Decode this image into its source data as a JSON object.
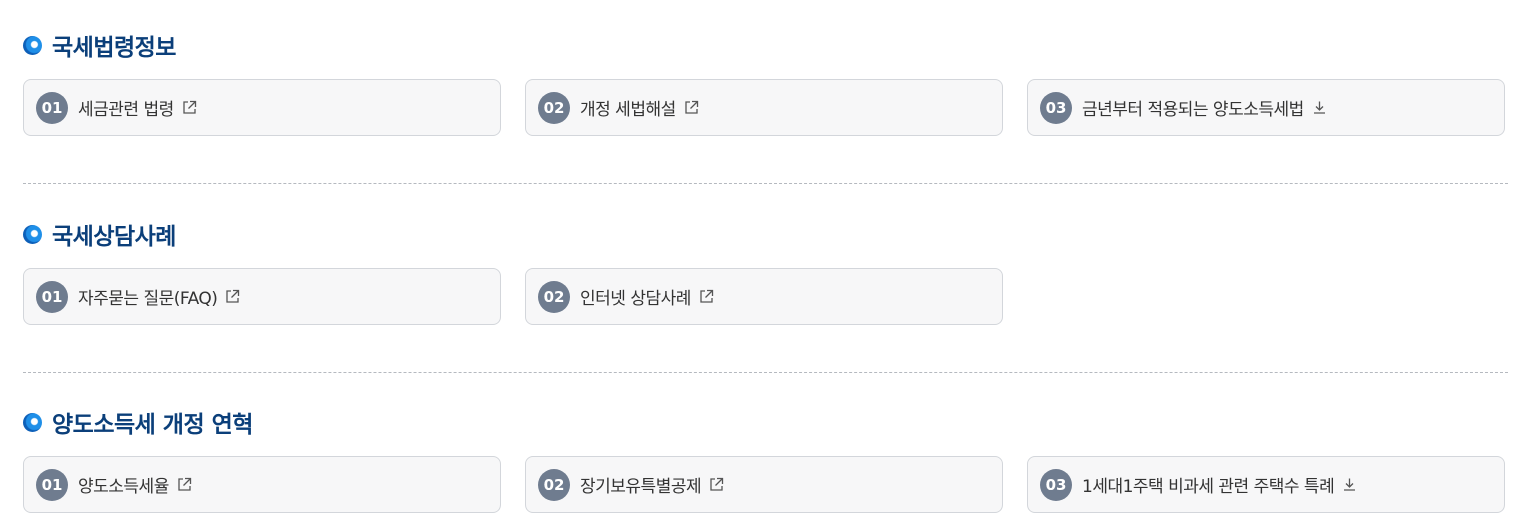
{
  "sections": [
    {
      "title": "국세법령정보",
      "items": [
        {
          "num": "01",
          "label": "세금관련 법령",
          "icon": "external-link-icon"
        },
        {
          "num": "02",
          "label": "개정 세법해설",
          "icon": "external-link-icon"
        },
        {
          "num": "03",
          "label": "금년부터 적용되는 양도소득세법",
          "icon": "download-icon"
        }
      ]
    },
    {
      "title": "국세상담사례",
      "items": [
        {
          "num": "01",
          "label": "자주묻는 질문(FAQ)",
          "icon": "external-link-icon"
        },
        {
          "num": "02",
          "label": "인터넷 상담사례",
          "icon": "external-link-icon"
        }
      ]
    },
    {
      "title": "양도소득세 개정 연혁",
      "items": [
        {
          "num": "01",
          "label": "양도소득세율",
          "icon": "external-link-icon"
        },
        {
          "num": "02",
          "label": "장기보유특별공제",
          "icon": "external-link-icon"
        },
        {
          "num": "03",
          "label": "1세대1주택 비과세 관련 주택수 특례",
          "icon": "download-icon"
        }
      ]
    }
  ],
  "colors": {
    "title": "#0b3f7a",
    "number_badge": "#6f7c8f",
    "card_bg": "#f7f7f8",
    "card_border": "#d3d6db"
  }
}
